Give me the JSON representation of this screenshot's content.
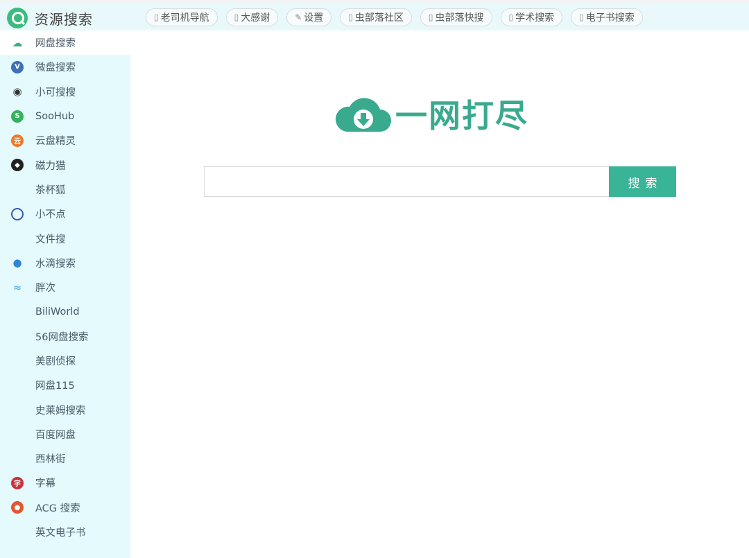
{
  "header": {
    "title": "资源搜索",
    "links": [
      {
        "icon": "▯",
        "label": "老司机导航"
      },
      {
        "icon": "▯",
        "label": "大感谢"
      },
      {
        "icon": "✎",
        "label": "设置"
      },
      {
        "icon": "▯",
        "label": "虫部落社区"
      },
      {
        "icon": "▯",
        "label": "虫部落快搜"
      },
      {
        "icon": "▯",
        "label": "学术搜索"
      },
      {
        "icon": "▯",
        "label": "电子书搜索"
      }
    ]
  },
  "sidebar": {
    "items": [
      {
        "label": "网盘搜索",
        "icon": "cloud-icon",
        "color": "#3aab8c"
      },
      {
        "label": "微盘搜索",
        "icon": "v-badge-icon",
        "color": "#3f6fb5"
      },
      {
        "label": "小可搜搜",
        "icon": "eye-icon",
        "color": "#333333"
      },
      {
        "label": "SooHub",
        "icon": "s-circle-icon",
        "color": "#36b35a"
      },
      {
        "label": "云盘精灵",
        "icon": "cloud-sprite-icon",
        "color": "#f07a2a"
      },
      {
        "label": "磁力猫",
        "icon": "cat-icon",
        "color": "#222222"
      },
      {
        "label": "茶杯狐",
        "icon": "",
        "color": ""
      },
      {
        "label": "小不点",
        "icon": "ring-icon",
        "color": "#3a5aa8"
      },
      {
        "label": "文件搜",
        "icon": "",
        "color": ""
      },
      {
        "label": "水滴搜索",
        "icon": "water-drop-icon",
        "color": "#2f86d6"
      },
      {
        "label": "胖次",
        "icon": "wave-icon",
        "color": "#69b7e8"
      },
      {
        "label": "BiliWorld",
        "icon": "",
        "color": ""
      },
      {
        "label": "56网盘搜索",
        "icon": "",
        "color": ""
      },
      {
        "label": "美剧侦探",
        "icon": "",
        "color": ""
      },
      {
        "label": "网盘115",
        "icon": "",
        "color": ""
      },
      {
        "label": "史莱姆搜索",
        "icon": "",
        "color": ""
      },
      {
        "label": "百度网盘",
        "icon": "",
        "color": ""
      },
      {
        "label": "西林街",
        "icon": "",
        "color": ""
      },
      {
        "label": "字幕",
        "icon": "subtitle-icon",
        "color": "#c9323a"
      },
      {
        "label": "ACG 搜索",
        "icon": "acg-icon",
        "color": "#e0562f"
      },
      {
        "label": "英文电子书",
        "icon": "",
        "color": ""
      }
    ]
  },
  "main": {
    "logo_text": "一网打尽",
    "search_placeholder": "",
    "search_button": "搜索"
  },
  "colors": {
    "accent": "#3ab497",
    "sidebar_bg": "#e4fafd",
    "topbar_bg": "#e8f8fb"
  }
}
